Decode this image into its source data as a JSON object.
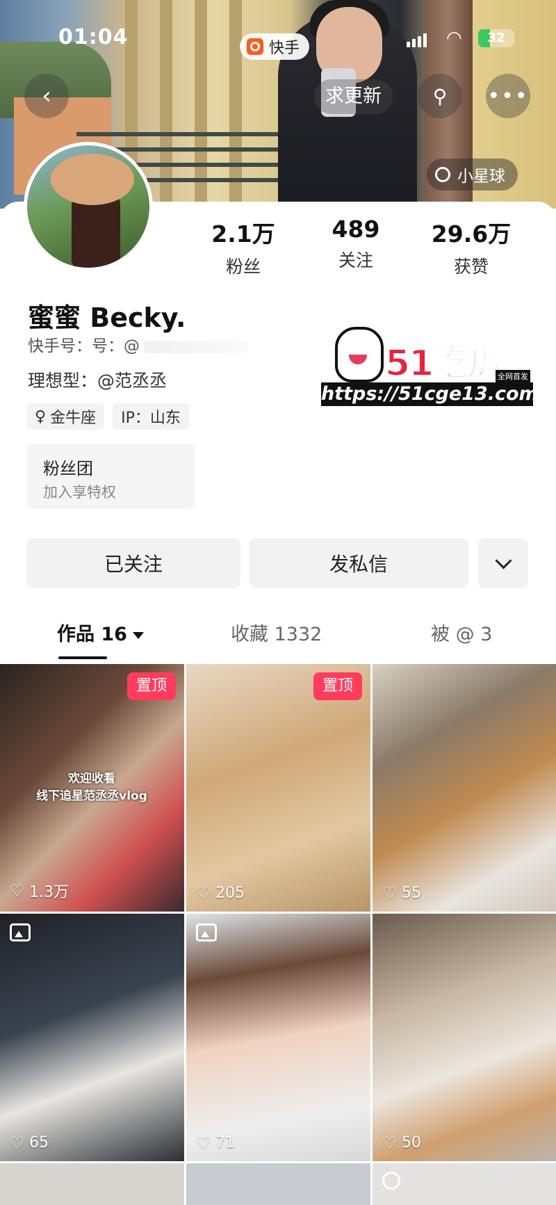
{
  "status_bar": {
    "time": "01:04",
    "app_name": "快手",
    "battery": "32"
  },
  "header": {
    "update_button": "求更新",
    "planet_label": "小星球"
  },
  "profile": {
    "name": "蜜蜜 Becky.",
    "kuaishou_id_label": "快手号：",
    "kuaishou_id_value": "号：@",
    "ideal_type": "理想型：@范丞丞",
    "tags": [
      "金牛座",
      "IP：山东"
    ],
    "fan_club": {
      "title": "粉丝团",
      "subtitle": "加入享特权"
    }
  },
  "stats": [
    {
      "value": "2.1万",
      "label": "粉丝"
    },
    {
      "value": "489",
      "label": "关注"
    },
    {
      "value": "29.6万",
      "label": "获赞"
    }
  ],
  "actions": {
    "follow": "已关注",
    "message": "发私信"
  },
  "tabs": [
    {
      "label": "作品 16"
    },
    {
      "label": "收藏 1332"
    },
    {
      "label": "被 @ 3"
    }
  ],
  "watermark": {
    "brand": "51吃瓜",
    "tagline": "全网首发",
    "url": "https://51cge13.com"
  },
  "posts": [
    {
      "likes": "1.3万",
      "pinned": "置顶",
      "overlay": "欢迎收看\n线下追星范丞丞vlog"
    },
    {
      "likes": "205",
      "pinned": "置顶"
    },
    {
      "likes": "55"
    },
    {
      "likes": "65"
    },
    {
      "likes": "71"
    },
    {
      "likes": "50"
    }
  ],
  "colors": {
    "pin_badge": "#ff3c5c",
    "brand_orange": "#ff5a1f",
    "watermark_red": "#e8223a"
  }
}
